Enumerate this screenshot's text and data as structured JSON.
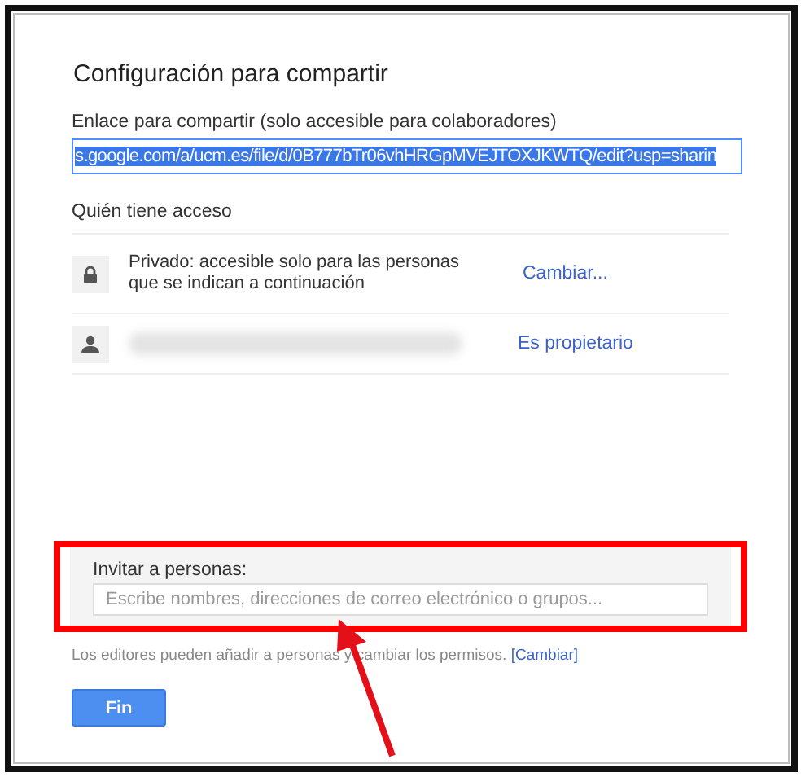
{
  "dialog": {
    "title": "Configuración para compartir",
    "link": {
      "label": "Enlace para compartir (solo accesible para colaboradores)",
      "value": "s.google.com/a/ucm.es/file/d/0B777bTr06vhHRGpMVEJTOXJKWTQ/edit?usp=sharin",
      "selected": true
    },
    "access": {
      "heading": "Quién tiene acceso",
      "rows": [
        {
          "kind": "visibility",
          "text": "Privado: accesible solo para las personas que se indican a continuación",
          "action": "Cambiar..."
        },
        {
          "kind": "person",
          "action": "Es propietario"
        }
      ]
    },
    "invite": {
      "label": "Invitar a personas:",
      "placeholder": "Escribe nombres, direcciones de correo electrónico o grupos...",
      "highlighted": true
    },
    "note": {
      "text": "Los editores pueden añadir a personas y cambiar los permisos.",
      "link": "[Cambiar]"
    },
    "done_button": "Fin"
  }
}
